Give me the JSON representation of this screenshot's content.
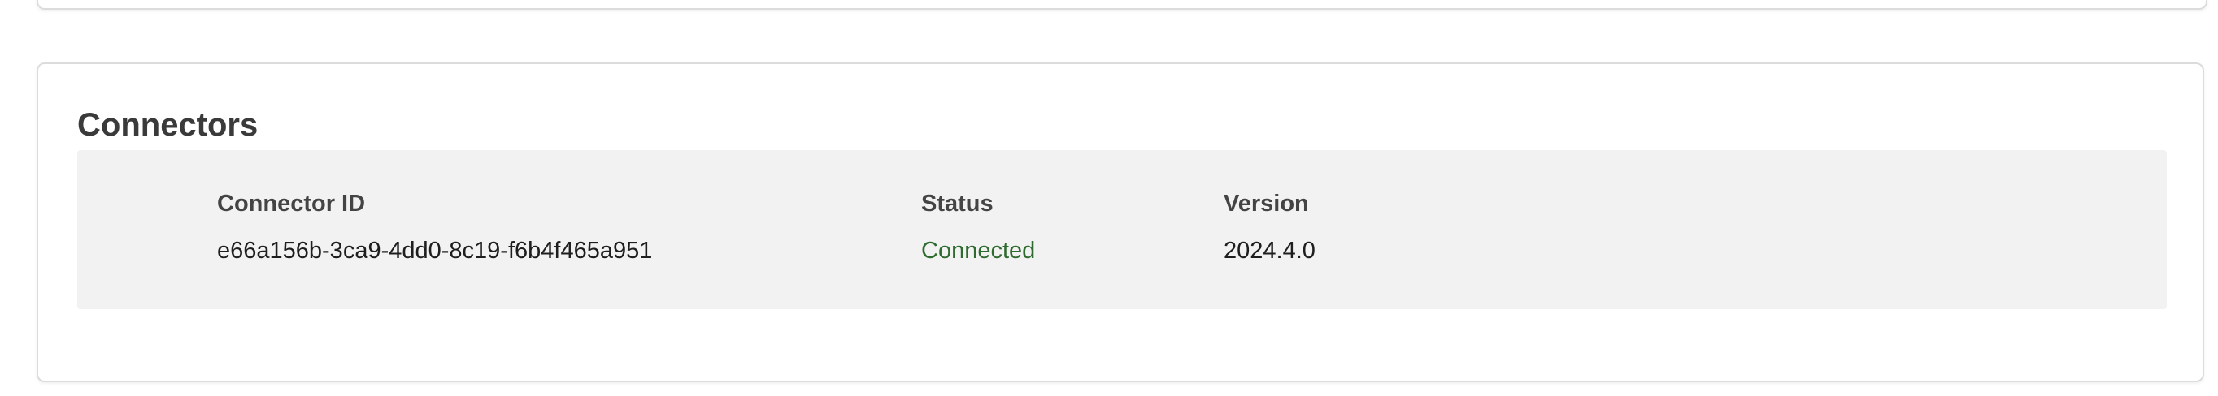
{
  "connectors": {
    "title": "Connectors",
    "columns": {
      "id": "Connector ID",
      "status": "Status",
      "version": "Version"
    },
    "rows": [
      {
        "id": "e66a156b-3ca9-4dd0-8c19-f6b4f465a951",
        "status": "Connected",
        "version": "2024.4.0"
      }
    ]
  },
  "colors": {
    "status_connected": "#2e6b2e",
    "panel_background": "#f2f2f2",
    "card_border": "#dcdcdc"
  }
}
